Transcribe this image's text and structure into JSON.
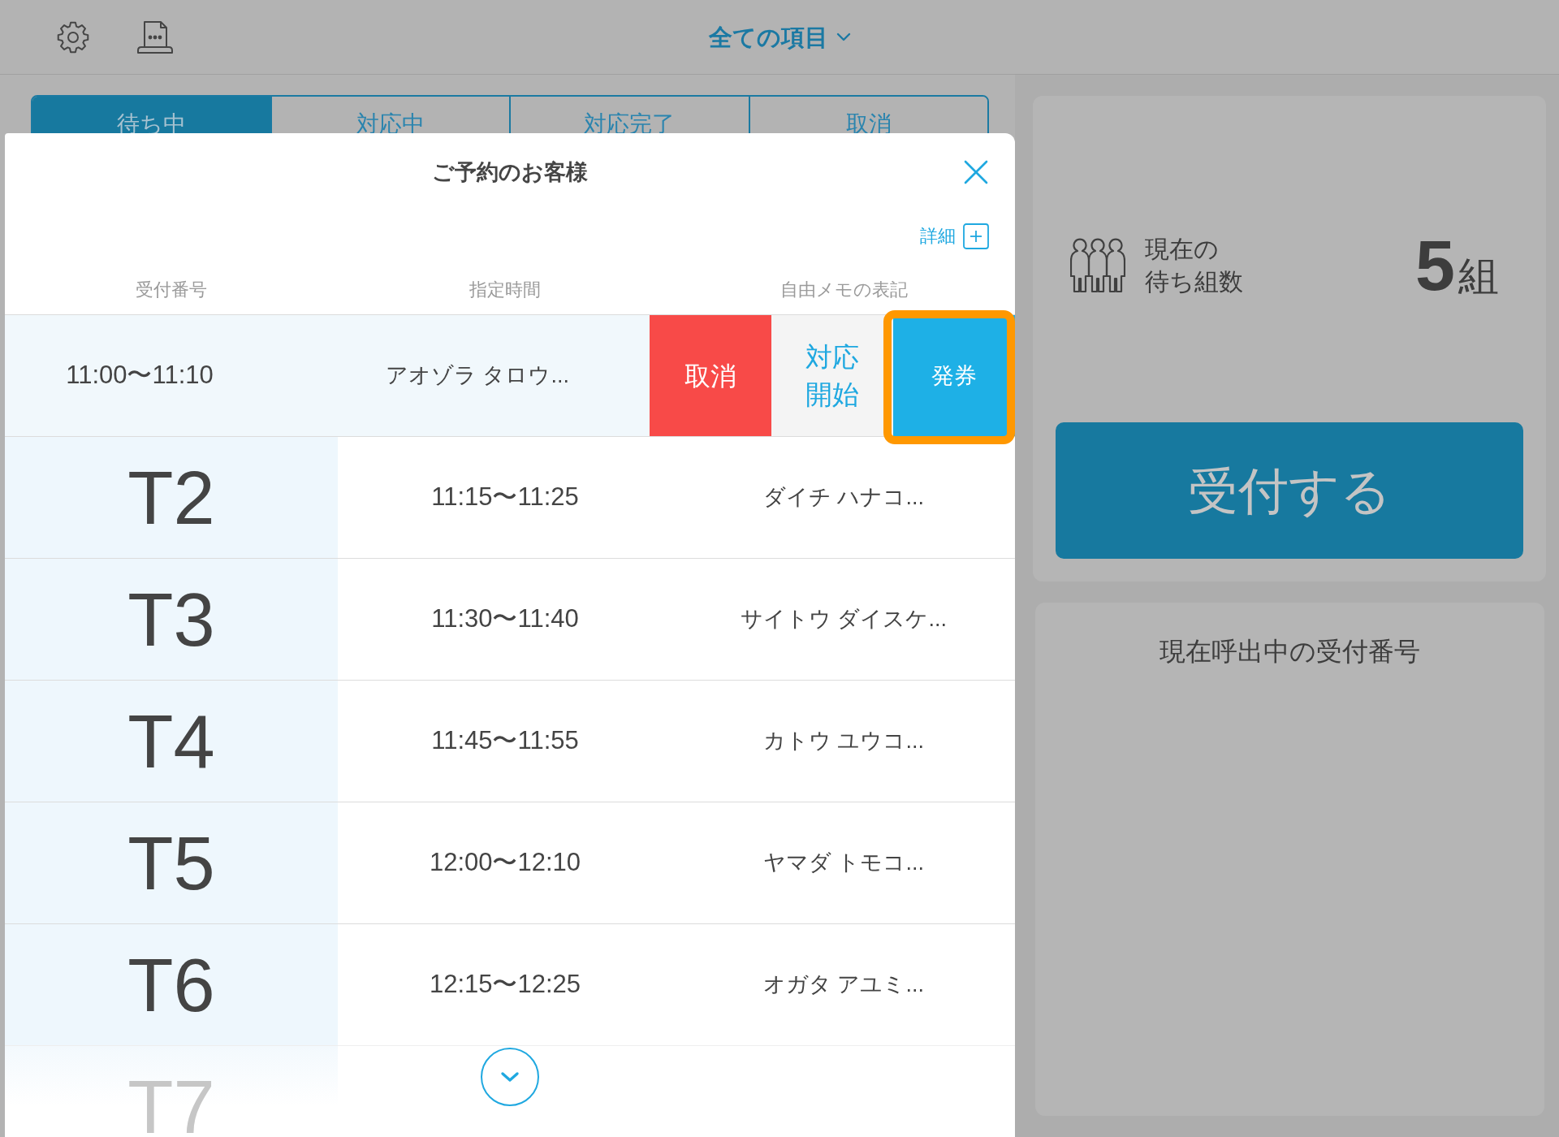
{
  "toolbar": {
    "title": "全ての項目"
  },
  "tabs": [
    {
      "label": "待ち中",
      "selected": true
    },
    {
      "label": "対応中",
      "selected": false
    },
    {
      "label": "対応完了",
      "selected": false
    },
    {
      "label": "取消",
      "selected": false
    }
  ],
  "modal": {
    "title": "ご予約のお客様",
    "detail_label": "詳細",
    "columns": [
      "受付番号",
      "指定時間",
      "自由メモの表記"
    ],
    "rows": [
      {
        "kind": "swiped",
        "shifted_time": "11:00〜11:10",
        "shifted_memo": "アオゾラ タロウ...",
        "actions": [
          {
            "kind": "cancel",
            "label": "取消",
            "highlighted": false
          },
          {
            "kind": "start",
            "label": "対応開始",
            "highlighted": false
          },
          {
            "kind": "ticket",
            "label": "発券",
            "highlighted": true
          }
        ]
      },
      {
        "kind": "normal",
        "number": "T2",
        "time": "11:15〜11:25",
        "memo": "ダイチ ハナコ..."
      },
      {
        "kind": "normal",
        "number": "T3",
        "time": "11:30〜11:40",
        "memo": "サイトウ ダイスケ..."
      },
      {
        "kind": "normal",
        "number": "T4",
        "time": "11:45〜11:55",
        "memo": "カトウ ユウコ..."
      },
      {
        "kind": "normal",
        "number": "T5",
        "time": "12:00〜12:10",
        "memo": "ヤマダ トモコ..."
      },
      {
        "kind": "normal",
        "number": "T6",
        "time": "12:15〜12:25",
        "memo": "オガタ アユミ..."
      },
      {
        "kind": "faded",
        "number": "T7"
      }
    ]
  },
  "waiting": {
    "label_lines": [
      "現在の",
      "待ち組数"
    ],
    "count": "5",
    "unit": "組"
  },
  "reception_button": {
    "label": "受付する"
  },
  "calling": {
    "title": "現在呼出中の受付番号"
  }
}
